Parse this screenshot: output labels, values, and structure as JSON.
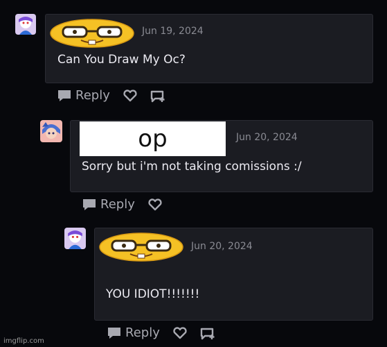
{
  "comments": [
    {
      "date": "Jun 19, 2024",
      "text": "Can You Draw My Oc?",
      "actions": {
        "reply_label": "Reply"
      }
    },
    {
      "date": "Jun 20, 2024",
      "redaction_label": "op",
      "text": "Sorry but i'm not taking comissions :/",
      "actions": {
        "reply_label": "Reply"
      }
    },
    {
      "date": "Jun 20, 2024",
      "text": "YOU IDIOT!!!!!!!",
      "actions": {
        "reply_label": "Reply"
      }
    }
  ],
  "watermark": "imgflip.com",
  "colors": {
    "background": "#07080c",
    "card": "#1b1c22",
    "text": "#ecebf2",
    "muted": "#8a8b93",
    "redact_box": "#ffffff"
  },
  "icons": [
    "avatar-image",
    "nerd-face-emoji",
    "reply-icon",
    "heart-icon",
    "gift-icon"
  ]
}
